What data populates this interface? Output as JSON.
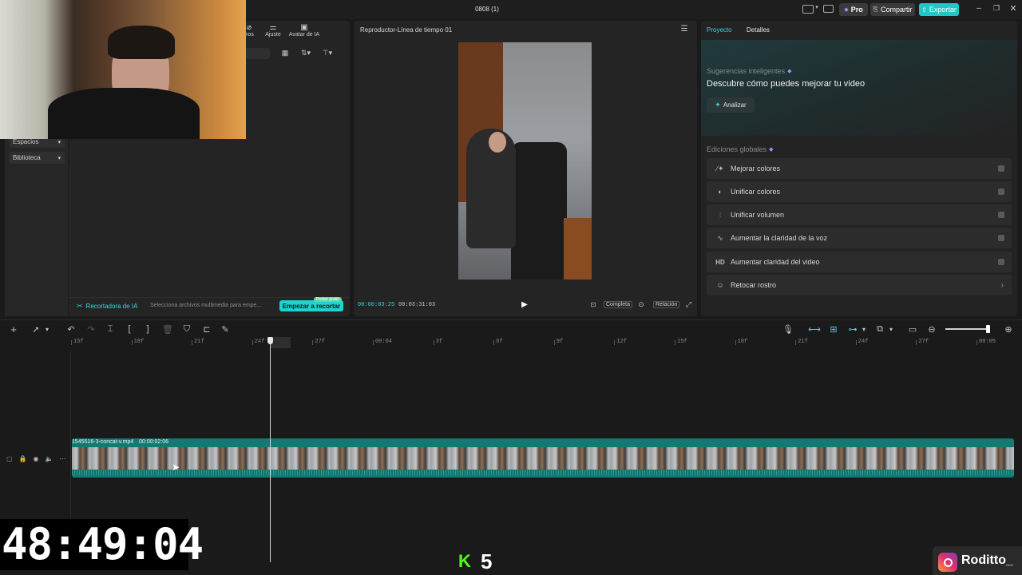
{
  "window": {
    "title": "0808 (1)",
    "pro_label": "Pro",
    "share_label": "Compartir",
    "export_label": "Exportar"
  },
  "toolbar_top": {
    "items": [
      {
        "label": "tros",
        "icon": "filter-icon"
      },
      {
        "label": "Ajuste",
        "icon": "sliders-icon"
      },
      {
        "label": "Avatar de IA",
        "icon": "avatar-icon"
      }
    ]
  },
  "sidebar": {
    "spaces_label": "Espacios",
    "library_label": "Biblioteca"
  },
  "media_panel": {
    "ai_cutter_label": "Recortadora de IA",
    "hint_text": "Selecciona archivos multimedia para empe...",
    "start_button": "Empezar a recortar",
    "trial_badge": "Probar gratis"
  },
  "player": {
    "title": "Reproductor-Línea de tiempo 01",
    "current_time": "00:00:03:25",
    "total_time": "00:03:31:03",
    "full_label": "Completa",
    "ratio_label": "Relación"
  },
  "right_panel": {
    "tab_project": "Proyecto",
    "tab_details": "Detalles",
    "smart_title": "Sugerencias inteligentes",
    "smart_subtitle": "Descubre cómo puedes mejorar tu video",
    "analyze_button": "Analizar",
    "global_title": "Ediciones globales",
    "global_items": [
      {
        "label": "Mejorar colores",
        "icon": "magic-wand-icon"
      },
      {
        "label": "Unificar colores",
        "icon": "color-drop-icon"
      },
      {
        "label": "Unificar volumen",
        "icon": "volume-bars-icon"
      },
      {
        "label": "Aumentar la claridad de la voz",
        "icon": "voice-wave-icon"
      },
      {
        "label": "Aumentar claridad del video",
        "icon": "hd-icon"
      },
      {
        "label": "Retocar rostro",
        "icon": "face-retouch-icon"
      }
    ]
  },
  "timeline": {
    "ticks": [
      "15f",
      "18f",
      "21f",
      "24f",
      "27f",
      "00:04",
      "3f",
      "6f",
      "9f",
      "12f",
      "15f",
      "18f",
      "21f",
      "24f",
      "27f",
      "00:05"
    ],
    "clip_name": "1545516-3-concat-v.mp4",
    "clip_duration": "00:00:02:06"
  },
  "overlay": {
    "stream_timer": "48:49:04",
    "kick_count": "5",
    "kick_letter": "K",
    "instagram_handle": "Roditto_"
  },
  "colors": {
    "accent": "#1ecbd6",
    "clip": "#117a72",
    "background": "#1a1a1a",
    "panel": "#242424"
  }
}
